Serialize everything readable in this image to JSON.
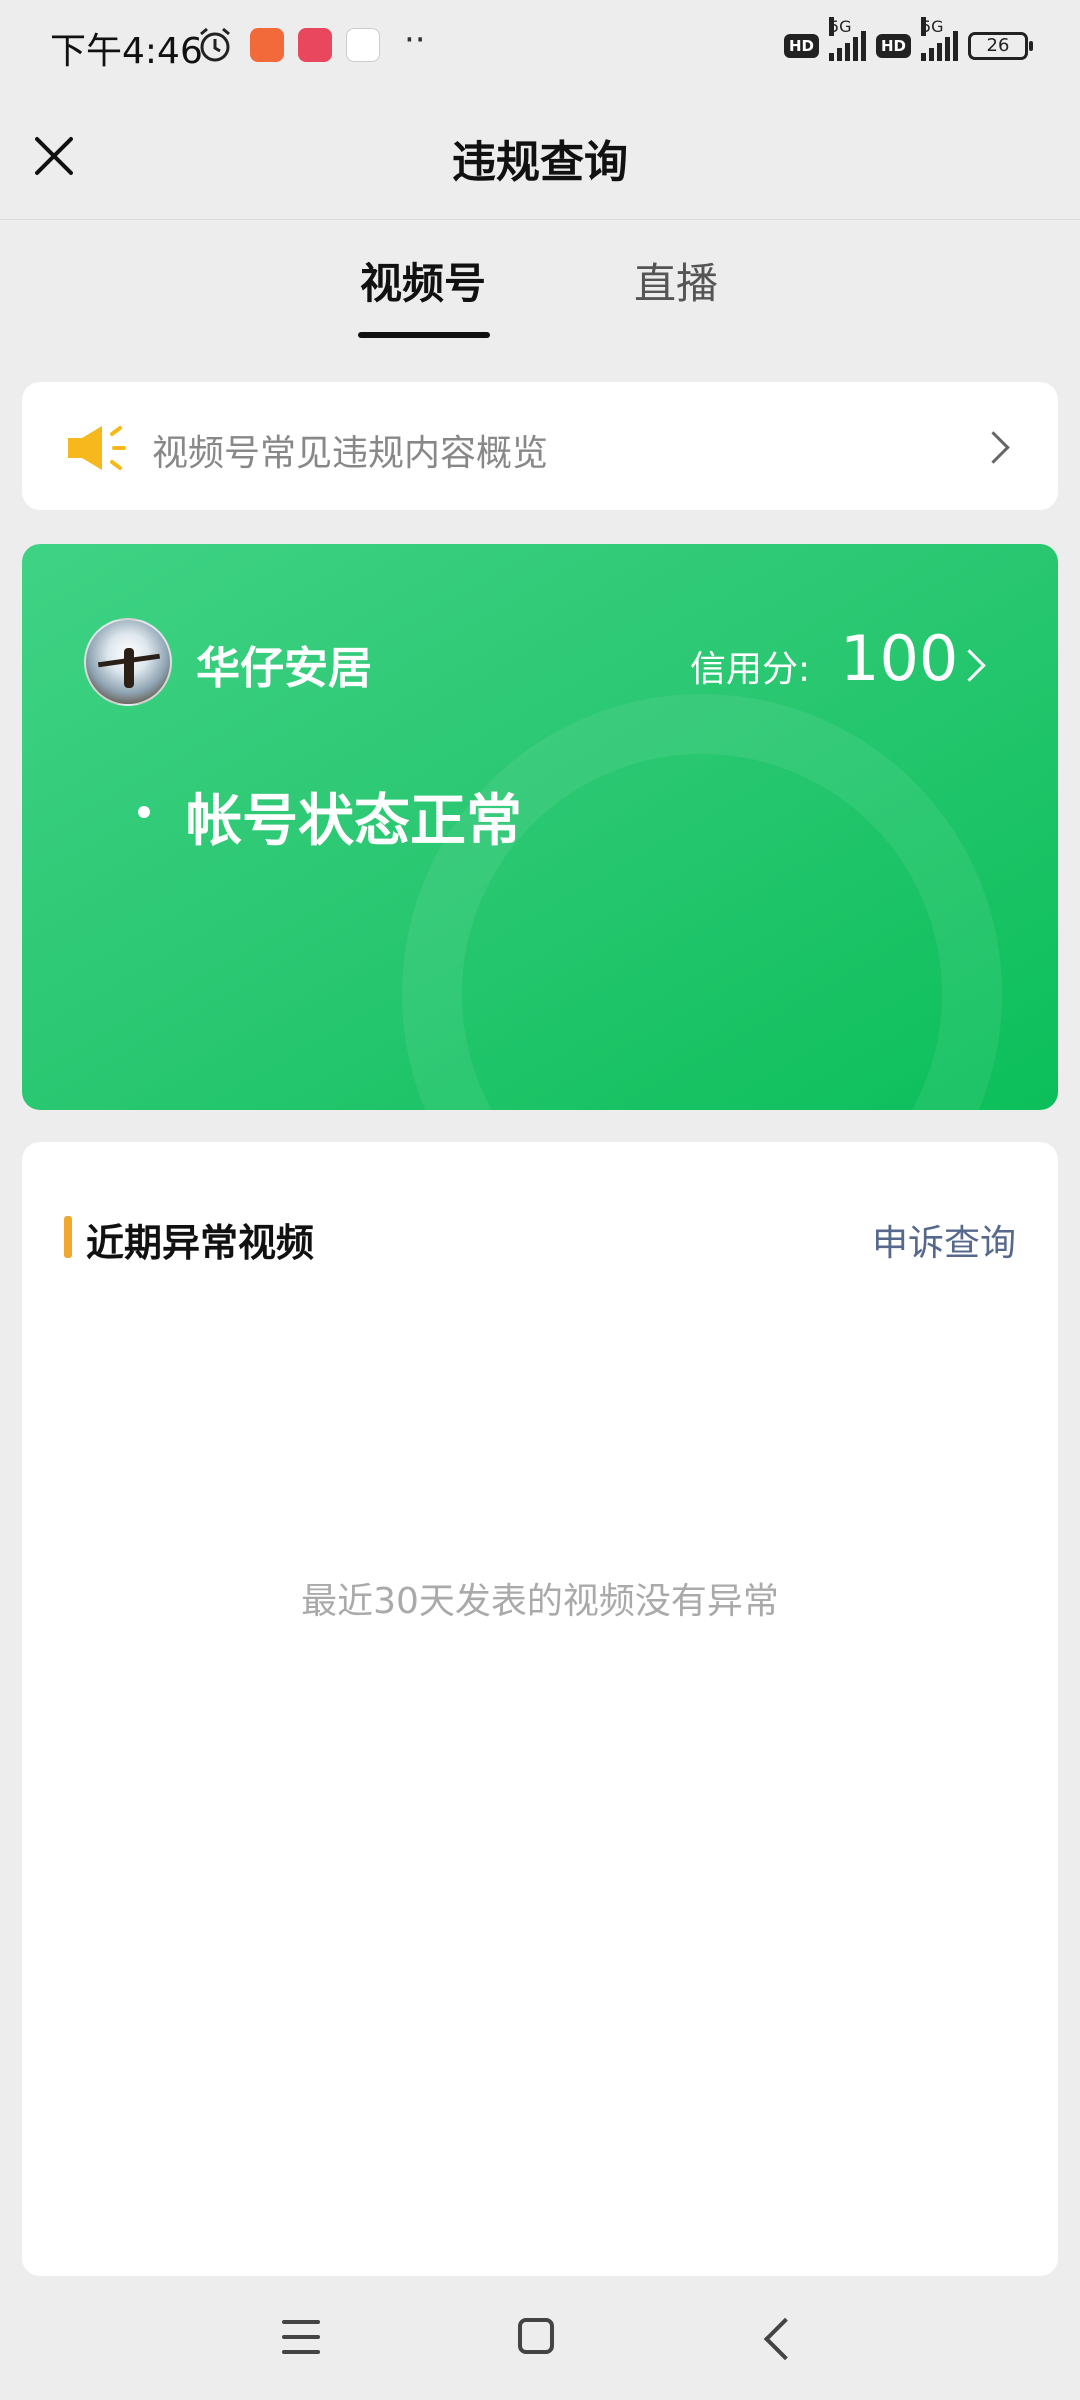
{
  "status_bar": {
    "time": "下午4:46",
    "network": "5G",
    "hd_label": "HD",
    "battery": "26"
  },
  "nav": {
    "title": "违规查询"
  },
  "tabs": [
    {
      "label": "视频号",
      "active": true
    },
    {
      "label": "直播",
      "active": false
    }
  ],
  "notice": {
    "text": "视频号常见违规内容概览"
  },
  "account": {
    "name": "华仔安居",
    "credit_label": "信用分:",
    "credit_value": "100",
    "status": "帐号状态正常"
  },
  "recent_videos": {
    "title": "近期异常视频",
    "appeal_link": "申诉查询",
    "empty_message": "最近30天发表的视频没有异常"
  },
  "colors": {
    "brand_green": "#2cc873",
    "accent_orange": "#f0a830",
    "link_blue": "#56698c"
  }
}
